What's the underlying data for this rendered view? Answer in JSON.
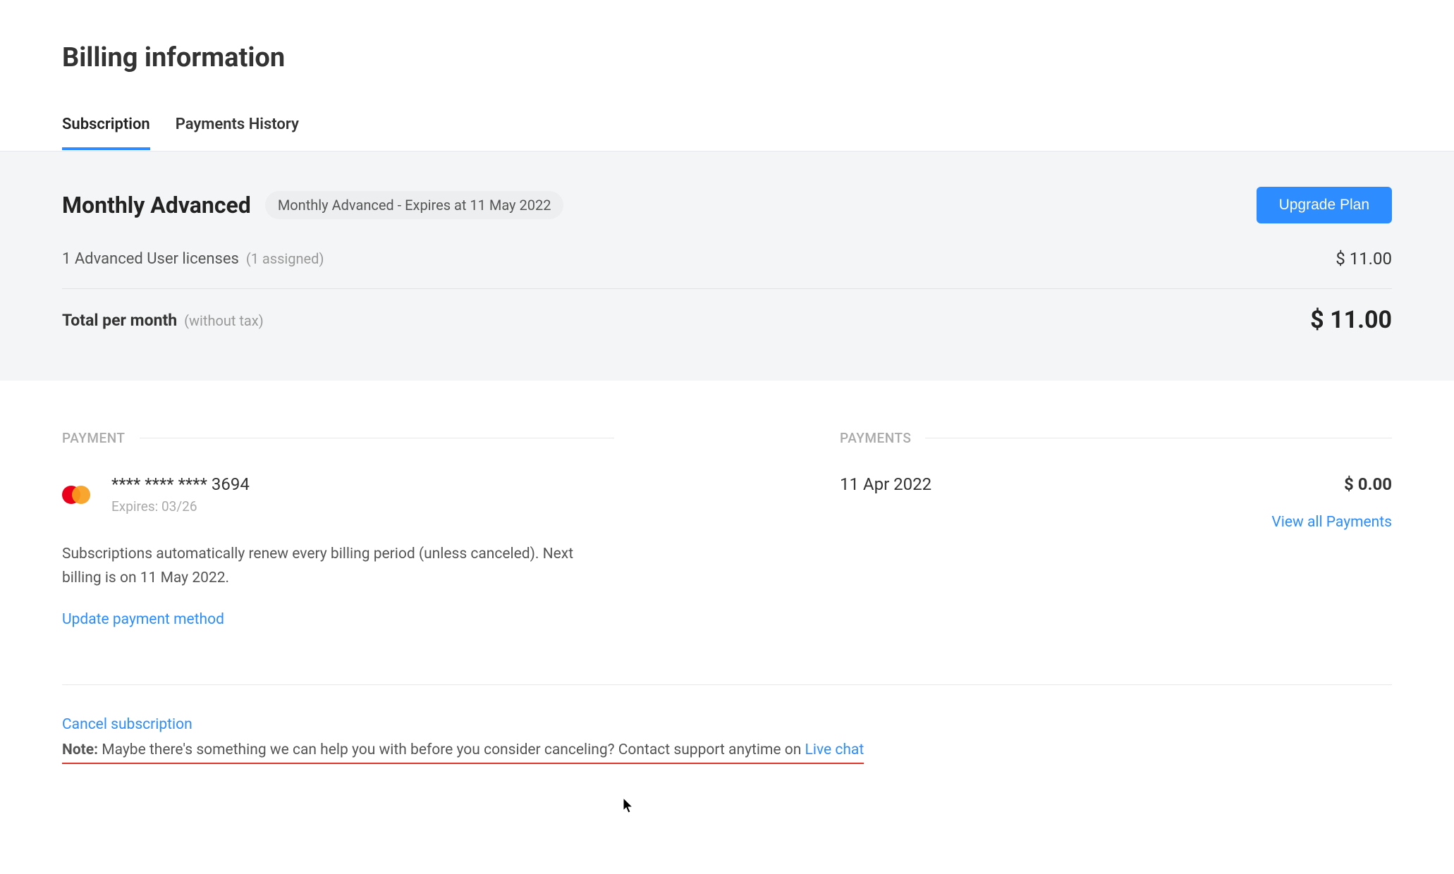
{
  "page": {
    "title": "Billing information"
  },
  "tabs": [
    {
      "label": "Subscription",
      "active": true
    },
    {
      "label": "Payments History",
      "active": false
    }
  ],
  "plan": {
    "name": "Monthly Advanced",
    "badge": "Monthly Advanced - Expires at 11 May 2022",
    "upgrade_button": "Upgrade Plan",
    "license_text": "1 Advanced User licenses",
    "license_assigned": "(1 assigned)",
    "license_price": "$ 11.00",
    "total_label": "Total per month",
    "total_sub": "(without tax)",
    "total_price": "$ 11.00"
  },
  "payment": {
    "heading": "PAYMENT",
    "card_number": "**** **** **** 3694",
    "card_expiry": "Expires: 03/26",
    "renewal_note": "Subscriptions automatically renew every billing period (unless canceled). Next billing is on 11 May 2022.",
    "update_link": "Update payment method"
  },
  "payments": {
    "heading": "PAYMENTS",
    "items": [
      {
        "date": "11 Apr 2022",
        "amount": "$ 0.00"
      }
    ],
    "view_all": "View all Payments"
  },
  "footer": {
    "cancel_link": "Cancel subscription",
    "note_label": "Note:",
    "note_text": " Maybe there's something we can help you with before you consider canceling? Contact support anytime on ",
    "live_chat": "Live chat"
  }
}
